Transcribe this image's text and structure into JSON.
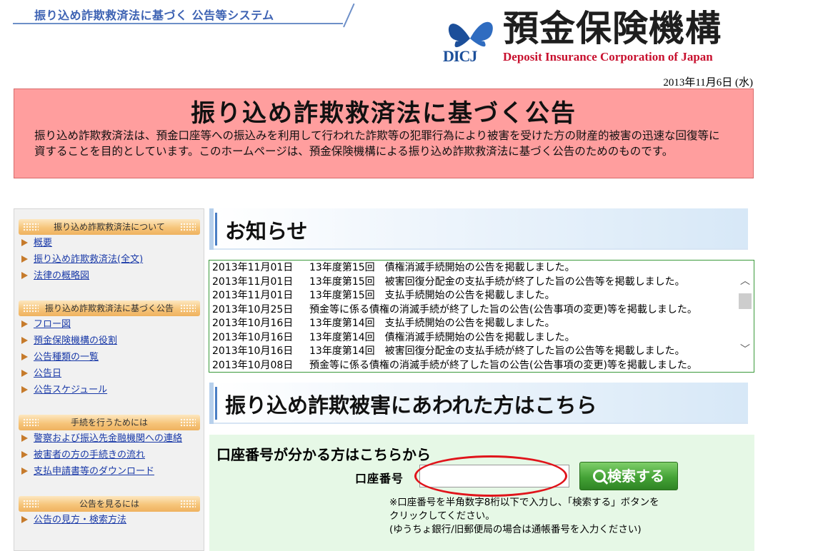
{
  "header": {
    "system_title": "振り込め詐欺救済法に基づく 公告等システム",
    "org_name_jp": "預金保険機構",
    "org_name_en": "Deposit Insurance Corporation of Japan",
    "logo_abbr": "DICJ",
    "date": "2013年11月6日 (水)"
  },
  "banner": {
    "title": "振り込め詐欺救済法に基づく公告",
    "description": "振り込め詐欺救済法は、預金口座等への振込みを利用して行われた詐欺等の犯罪行為により被害を受けた方の財産的被害の迅速な回復等に資することを目的としています。このホームページは、預金保険機構による振り込め詐欺救済法に基づく公告のためのものです。"
  },
  "sidebar": {
    "sections": [
      {
        "title": "振り込め詐欺救済法について",
        "items": [
          "概要",
          "振り込め詐欺救済法(全文)",
          "法律の概略図"
        ]
      },
      {
        "title": "振り込め詐欺救済法に基づく公告",
        "items": [
          "フロー図",
          "預金保険機構の役割",
          "公告種類の一覧",
          "公告日",
          "公告スケジュール"
        ]
      },
      {
        "title": "手続を行うためには",
        "items": [
          "警察および振込先金融機関への連絡",
          "被害者の方の手続きの流れ",
          "支払申請書等のダウンロード"
        ]
      },
      {
        "title": "公告を見るには",
        "items": [
          "公告の見方・検索方法"
        ]
      }
    ]
  },
  "news": {
    "heading": "お知らせ",
    "items": [
      {
        "date": "2013年11月01日",
        "text": "13年度第15回　債権消滅手続開始の公告を掲載しました。"
      },
      {
        "date": "2013年11月01日",
        "text": "13年度第15回　被害回復分配金の支払手続が終了した旨の公告等を掲載しました。"
      },
      {
        "date": "2013年11月01日",
        "text": "13年度第15回　支払手続開始の公告を掲載しました。"
      },
      {
        "date": "2013年10月25日",
        "text": "預金等に係る債権の消滅手続が終了した旨の公告(公告事項の変更)等を掲載しました。"
      },
      {
        "date": "2013年10月16日",
        "text": "13年度第14回　支払手続開始の公告を掲載しました。"
      },
      {
        "date": "2013年10月16日",
        "text": "13年度第14回　債権消滅手続開始の公告を掲載しました。"
      },
      {
        "date": "2013年10月16日",
        "text": "13年度第14回　被害回復分配金の支払手続が終了した旨の公告等を掲載しました。"
      },
      {
        "date": "2013年10月08日",
        "text": "預金等に係る債権の消滅手続が終了した旨の公告(公告事項の変更)等を掲載しました。"
      }
    ]
  },
  "victim": {
    "heading": "振り込め詐欺被害にあわれた方はこちら",
    "search_title": "口座番号が分かる方はこちらから",
    "account_label": "口座番号",
    "account_value": "",
    "search_button": "検索する",
    "note_lines": [
      "※口座番号を半角数字8桁以下で入力し、「検索する」ボタンを",
      "クリックしてください。",
      "(ゆうちょ銀行/旧郵便局の場合は通帳番号を入力ください)"
    ]
  },
  "colors": {
    "banner_bg": "#ff9e9e",
    "link": "#1a3aa8",
    "search_bg": "#e6f8e6",
    "button_green": "#44a236",
    "highlight_ring": "#e0141b"
  }
}
